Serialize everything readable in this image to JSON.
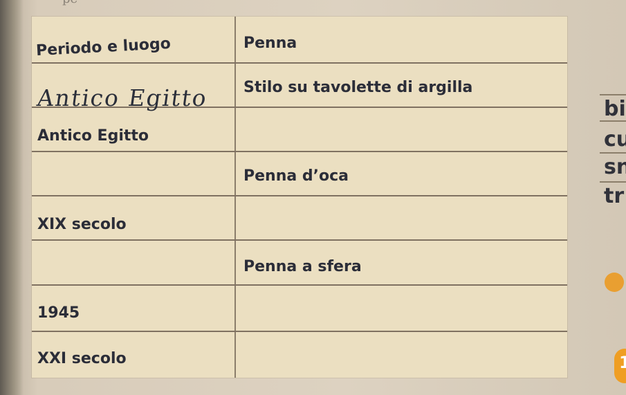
{
  "table": {
    "headers": {
      "left": "Periodo e luogo",
      "right": "Penna"
    },
    "cells": {
      "r1_left_handwritten": "Antico Egitto",
      "r1_right": "Stilo su tavolette di argilla",
      "r2_left": "Antico Egitto",
      "r3_right": "Penna d’oca",
      "r4_left": "XIX secolo",
      "r5_right": "Penna a sfera",
      "r6_left": "1945",
      "r7_left": "XXI secolo"
    }
  },
  "right_fragments": [
    "bi",
    "cu",
    "sn",
    "tr"
  ],
  "badge": "1",
  "colors": {
    "paper": "#ebdfc1",
    "ink": "#2b2d38",
    "accent": "#e99f31"
  }
}
